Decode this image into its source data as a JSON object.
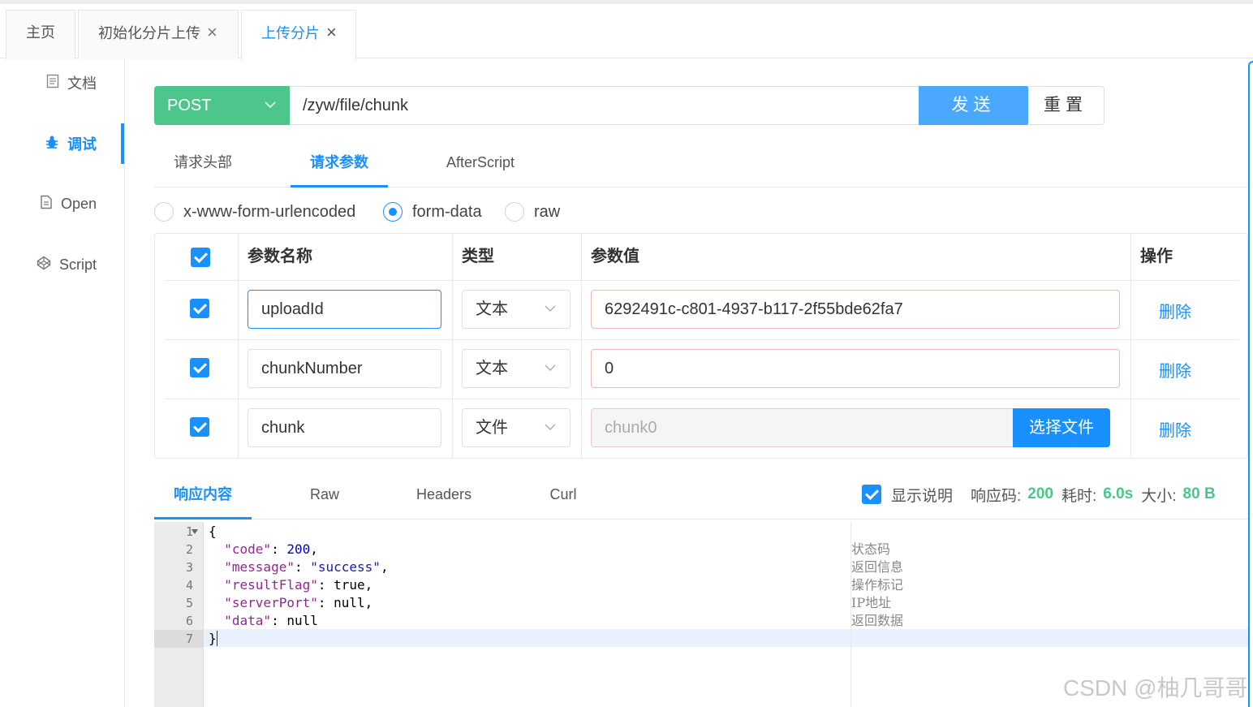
{
  "tabs": [
    {
      "label": "主页"
    },
    {
      "label": "初始化分片上传",
      "close": "×"
    },
    {
      "label": "上传分片",
      "close": "×"
    }
  ],
  "sidebar": {
    "items": [
      {
        "label": "文档",
        "icon": "doc-icon"
      },
      {
        "label": "调试",
        "icon": "bug-icon"
      },
      {
        "label": "Open",
        "icon": "file-icon"
      },
      {
        "label": "Script",
        "icon": "codepen-icon"
      }
    ]
  },
  "request": {
    "method": "POST",
    "url": "/zyw/file/chunk",
    "send_label": "发送",
    "reset_label": "重置"
  },
  "subtabs": [
    "请求头部",
    "请求参数",
    "AfterScript"
  ],
  "body_types": [
    "x-www-form-urlencoded",
    "form-data",
    "raw"
  ],
  "selected_body_type": "form-data",
  "params": {
    "headers": [
      "参数名称",
      "类型",
      "参数值",
      "操作"
    ],
    "rows": [
      {
        "name": "uploadId",
        "type": "文本",
        "value": "6292491c-c801-4937-b117-2f55bde62fa7",
        "action": "删除"
      },
      {
        "name": "chunkNumber",
        "type": "文本",
        "value": "0",
        "action": "删除"
      },
      {
        "name": "chunk",
        "type": "文件",
        "value": "chunk0",
        "pick_label": "选择文件",
        "action": "删除"
      }
    ]
  },
  "response": {
    "tabs": [
      "响应内容",
      "Raw",
      "Headers",
      "Curl"
    ],
    "show_desc_label": "显示说明",
    "code_label": "响应码:",
    "code": "200",
    "time_label": "耗时:",
    "time": "6.0s",
    "size_label": "大小:",
    "size": "80 B",
    "line_numbers": [
      "1",
      "2",
      "3",
      "4",
      "5",
      "6",
      "7"
    ],
    "json": {
      "code_key": "\"code\"",
      "code_val": "200",
      "message_key": "\"message\"",
      "message_val": "\"success\"",
      "resultFlag_key": "\"resultFlag\"",
      "resultFlag_val": "true",
      "serverPort_key": "\"serverPort\"",
      "serverPort_val": "null",
      "data_key": "\"data\"",
      "data_val": "null"
    },
    "comments": [
      "状态码",
      "返回信息",
      "操作标记",
      "IP地址",
      "返回数据"
    ]
  },
  "watermark": "CSDN @柚几哥哥",
  "colors": {
    "accent": "#1890ff",
    "method_green": "#4cc68a",
    "send_blue": "#4aa9ff"
  }
}
